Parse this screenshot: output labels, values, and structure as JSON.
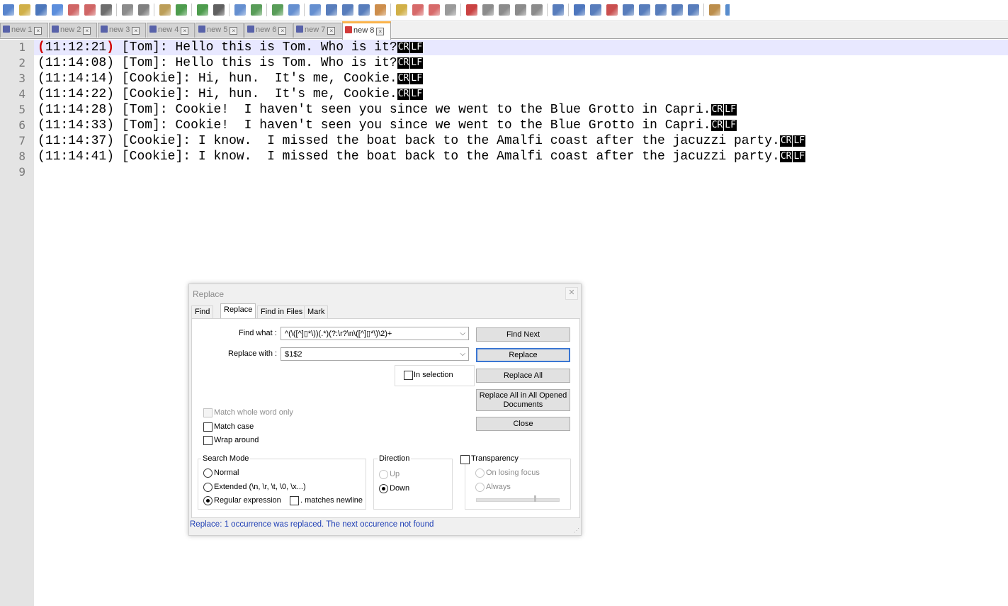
{
  "toolbar": {
    "icons": [
      "new-file",
      "open-file",
      "save",
      "save-all",
      "close",
      "close-all",
      "print",
      "cut",
      "copy",
      "paste",
      "undo",
      "redo",
      "find",
      "replace",
      "zoom-in",
      "zoom-out",
      "sync-vertical",
      "sync-horizontal",
      "word-wrap",
      "show-all-characters",
      "indent-guide",
      "user-defined-language",
      "document-map",
      "function-list",
      "folder-as-workspace",
      "monitoring",
      "record-macro",
      "stop-recording",
      "playback-macro",
      "run-macro-multiple",
      "save-macro",
      "spell-check",
      "spell-next",
      "column-view",
      "compare",
      "clear-compare",
      "previous-diff",
      "next-diff",
      "first-diff",
      "last-diff",
      "file-browser",
      "python-script"
    ]
  },
  "tabs": [
    {
      "label": "new 1",
      "active": false
    },
    {
      "label": "new 2",
      "active": false
    },
    {
      "label": "new 3",
      "active": false
    },
    {
      "label": "new 4",
      "active": false
    },
    {
      "label": "new 5",
      "active": false
    },
    {
      "label": "new 6",
      "active": false
    },
    {
      "label": "new 7",
      "active": false
    },
    {
      "label": "new 8",
      "active": true
    }
  ],
  "editor": {
    "lines": [
      {
        "num": "1",
        "open": "(",
        "time": "11:12:21",
        "close": ")",
        "text": " [Tom]: Hello this is Tom. Who is it?",
        "eol": [
          "CR",
          "LF"
        ]
      },
      {
        "num": "2",
        "open": "(",
        "time": "11:14:08",
        "close": ")",
        "text": " [Tom]: Hello this is Tom. Who is it?",
        "eol": [
          "CR",
          "LF"
        ]
      },
      {
        "num": "3",
        "open": "(",
        "time": "11:14:14",
        "close": ")",
        "text": " [Cookie]: Hi, hun.  It's me, Cookie.",
        "eol": [
          "CR",
          "LF"
        ]
      },
      {
        "num": "4",
        "open": "(",
        "time": "11:14:22",
        "close": ")",
        "text": " [Cookie]: Hi, hun.  It's me, Cookie.",
        "eol": [
          "CR",
          "LF"
        ]
      },
      {
        "num": "5",
        "open": "(",
        "time": "11:14:28",
        "close": ")",
        "text": " [Tom]: Cookie!  I haven't seen you since we went to the Blue Grotto in Capri.",
        "eol": [
          "CR",
          "LF"
        ]
      },
      {
        "num": "6",
        "open": "(",
        "time": "11:14:33",
        "close": ")",
        "text": " [Tom]: Cookie!  I haven't seen you since we went to the Blue Grotto in Capri.",
        "eol": [
          "CR",
          "LF"
        ]
      },
      {
        "num": "7",
        "open": "(",
        "time": "11:14:37",
        "close": ")",
        "text": " [Cookie]: I know.  I missed the boat back to the Amalfi coast after the jacuzzi party.",
        "eol": [
          "CR",
          "LF"
        ]
      },
      {
        "num": "8",
        "open": "(",
        "time": "11:14:41",
        "close": ")",
        "text": " [Cookie]: I know.  I missed the boat back to the Amalfi coast after the jacuzzi party.",
        "eol": [
          "CR",
          "LF"
        ]
      },
      {
        "num": "9",
        "open": "",
        "time": "",
        "close": "",
        "text": "",
        "eol": []
      }
    ]
  },
  "dialog": {
    "title": "Replace",
    "close_glyph": "✕",
    "tabs": [
      "Find",
      "Replace",
      "Find in Files",
      "Mark"
    ],
    "active_tab": "Replace",
    "find_label": "Find what :",
    "find_value": "^(\\([^]▯*\\))(.*)(?:\\r?\\n\\([^]▯*\\)\\2)+",
    "replace_label": "Replace with :",
    "replace_value": "$1$2",
    "combo_arrow": "⌵",
    "in_selection": "In selection",
    "buttons": {
      "find_next": "Find Next",
      "replace": "Replace",
      "replace_all": "Replace All",
      "replace_all_opened": "Replace All in All Opened Documents",
      "close": "Close"
    },
    "options": {
      "match_whole_word": "Match whole word only",
      "match_case": "Match case",
      "wrap_around": "Wrap around"
    },
    "search_mode": {
      "title": "Search Mode",
      "normal": "Normal",
      "extended": "Extended (\\n, \\r, \\t, \\0, \\x...)",
      "regex": "Regular expression",
      "matches_newline": ". matches newline",
      "selected": "regex"
    },
    "direction": {
      "title": "Direction",
      "up": "Up",
      "down": "Down",
      "selected": "down"
    },
    "transparency": {
      "title": "Transparency",
      "on_losing_focus": "On losing focus",
      "always": "Always"
    },
    "status": "Replace: 1 occurrence was replaced. The next occurence not found"
  },
  "colors": {
    "current_line": "#e8e8ff",
    "brace_highlight": "#d10000",
    "active_tab_accent": "#fab34b",
    "status_text": "#1f3fb5"
  }
}
